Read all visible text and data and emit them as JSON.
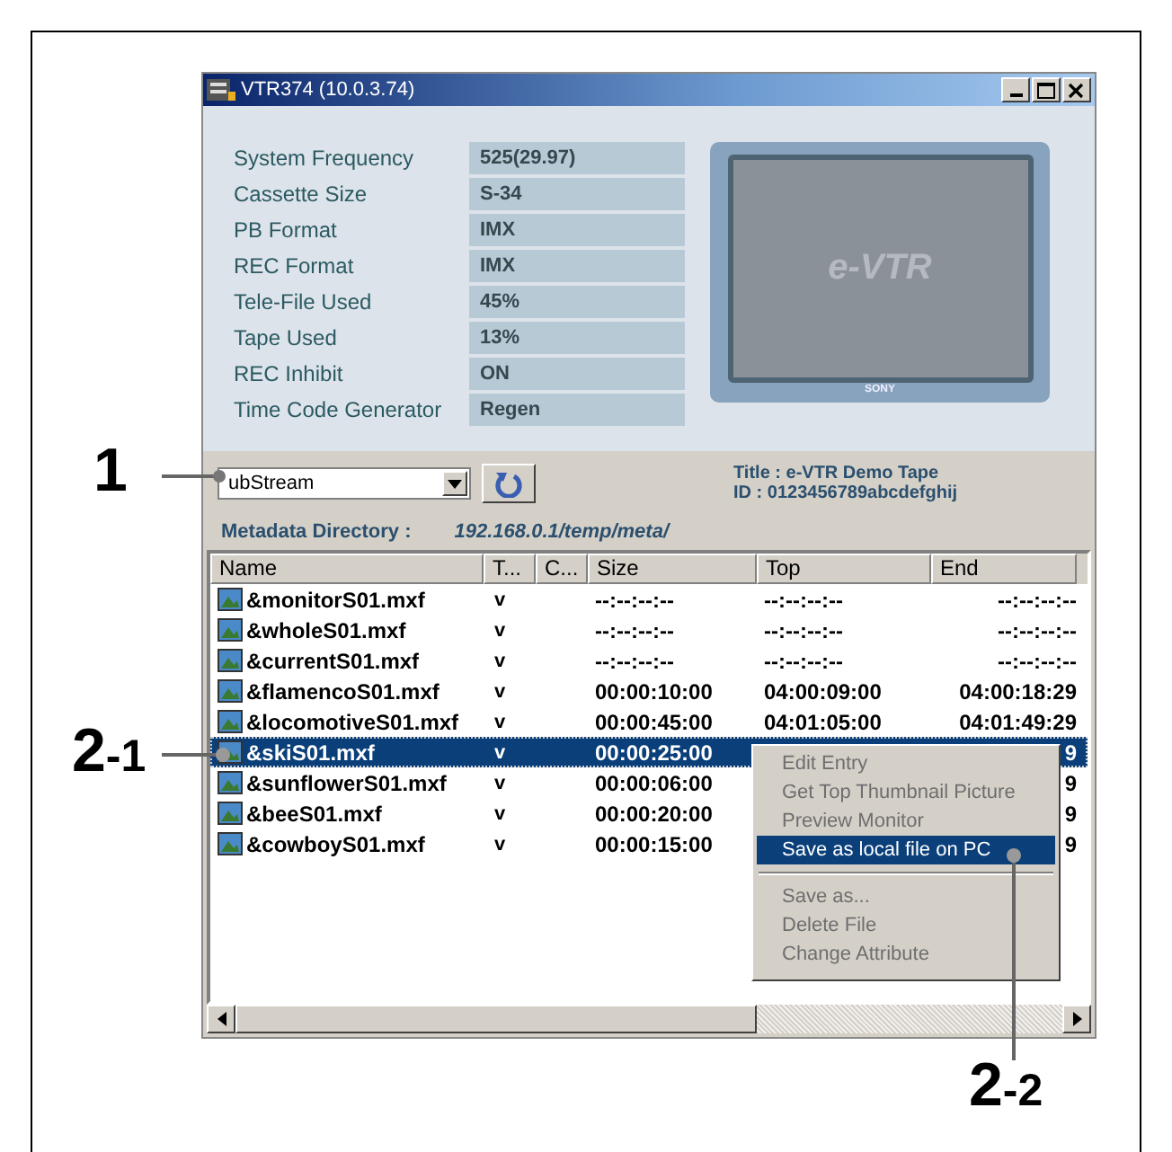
{
  "window": {
    "title": "VTR374 (10.0.3.74)"
  },
  "info": [
    {
      "label": "System Frequency",
      "value": "525(29.97)"
    },
    {
      "label": "Cassette Size",
      "value": "S-34"
    },
    {
      "label": "PB Format",
      "value": "IMX"
    },
    {
      "label": "REC Format",
      "value": "IMX"
    },
    {
      "label": "Tele-File Used",
      "value": "45%"
    },
    {
      "label": "Tape Used",
      "value": "13%"
    },
    {
      "label": "REC Inhibit",
      "value": "ON"
    },
    {
      "label": "Time Code Generator",
      "value": "Regen"
    }
  ],
  "monitor": {
    "logo": "e-VTR",
    "brand": "SONY"
  },
  "stream_select": {
    "value": "ubStream"
  },
  "tape": {
    "title": "Title : e-VTR Demo Tape",
    "id": "ID : 0123456789abcdefghij"
  },
  "metadata_directory": {
    "label": "Metadata Directory :",
    "value": "192.168.0.1/temp/meta/"
  },
  "file_list": {
    "columns": [
      "Name",
      "T...",
      "C...",
      "Size",
      "Top",
      "End"
    ],
    "rows": [
      {
        "name": "&monitorS01.mxf",
        "t": "v",
        "size": "--:--:--:--",
        "top": "--:--:--:--",
        "end": "--:--:--:--",
        "selected": false
      },
      {
        "name": "&wholeS01.mxf",
        "t": "v",
        "size": "--:--:--:--",
        "top": "--:--:--:--",
        "end": "--:--:--:--",
        "selected": false
      },
      {
        "name": "&currentS01.mxf",
        "t": "v",
        "size": "--:--:--:--",
        "top": "--:--:--:--",
        "end": "--:--:--:--",
        "selected": false
      },
      {
        "name": "&flamencoS01.mxf",
        "t": "v",
        "size": "00:00:10:00",
        "top": "04:00:09:00",
        "end": "04:00:18:29",
        "selected": false
      },
      {
        "name": "&locomotiveS01.mxf",
        "t": "v",
        "size": "00:00:45:00",
        "top": "04:01:05:00",
        "end": "04:01:49:29",
        "selected": false
      },
      {
        "name": "&skiS01.mxf",
        "t": "v",
        "size": "00:00:25:00",
        "end": "9",
        "selected": true
      },
      {
        "name": "&sunflowerS01.mxf",
        "t": "v",
        "size": "00:00:06:00",
        "end": "9",
        "selected": false
      },
      {
        "name": "&beeS01.mxf",
        "t": "v",
        "size": "00:00:20:00",
        "end": "9",
        "selected": false
      },
      {
        "name": "&cowboyS01.mxf",
        "t": "v",
        "size": "00:00:15:00",
        "end": "9",
        "selected": false
      }
    ]
  },
  "context_menu": {
    "items": [
      {
        "kind": "item",
        "label": "Edit Entry",
        "disabled": true,
        "selected": false
      },
      {
        "kind": "item",
        "label": "Get Top Thumbnail Picture",
        "disabled": true,
        "selected": false
      },
      {
        "kind": "item",
        "label": "Preview Monitor",
        "disabled": true,
        "selected": false
      },
      {
        "kind": "item",
        "label": "Save as local file on PC",
        "disabled": false,
        "selected": true
      },
      {
        "kind": "separator"
      },
      {
        "kind": "item",
        "label": "Save as...",
        "disabled": true,
        "selected": false
      },
      {
        "kind": "item",
        "label": "Delete File",
        "disabled": true,
        "selected": false
      },
      {
        "kind": "item",
        "label": "Change Attribute",
        "disabled": true,
        "selected": false
      }
    ]
  },
  "callouts": [
    {
      "number": "1"
    },
    {
      "number": "2",
      "suffix": "-1"
    },
    {
      "number": "2",
      "suffix": "-2"
    }
  ]
}
